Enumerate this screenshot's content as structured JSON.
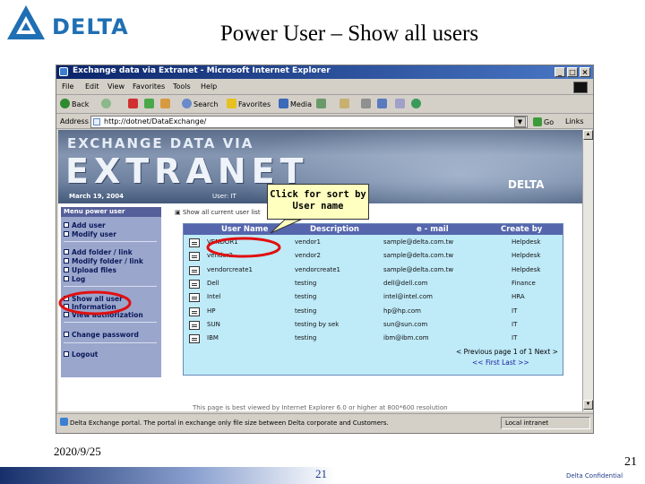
{
  "slide": {
    "logo_text": "DELTA",
    "title": "Power User – Show all users",
    "footer_date": "2020/9/25",
    "footer_page_center": "21",
    "footer_page_right": "21",
    "footer_confidential": "Delta Confidential"
  },
  "browser": {
    "window_title": "Exchange data via Extranet - Microsoft Internet Explorer",
    "menu": [
      "File",
      "Edit",
      "View",
      "Favorites",
      "Tools",
      "Help"
    ],
    "toolbar": {
      "back": "Back",
      "search": "Search",
      "favorites": "Favorites",
      "media": "Media"
    },
    "address_label": "Address",
    "address_value": "http://dotnet/DataExchange/",
    "go_label": "Go",
    "links_label": "Links",
    "status_message": "Delta Exchange portal. The portal in exchange only file size between Delta corporate and Customers.",
    "status_zone": "Local intranet"
  },
  "page": {
    "banner_line1": "EXCHANGE DATA VIA",
    "banner_line2": "EXTRANET",
    "banner_date": "March 19, 2004",
    "banner_user": "User: IT",
    "banner_logo": "DELTA",
    "menu_header": "Menu power user",
    "nav": [
      "Add user",
      "Modify user",
      "Add folder / link",
      "Modify folder / link",
      "Upload files",
      "Log",
      "Show all user",
      "Information",
      "View authorization",
      "Change password",
      "Logout"
    ],
    "breadcrumb": "Show all current user list",
    "table": {
      "headers": [
        "User Name",
        "Description",
        "e - mail",
        "Create by"
      ],
      "rows": [
        [
          "VENDOR1",
          "vendor1",
          "sample@delta.com.tw",
          "Helpdesk"
        ],
        [
          "vendor2",
          "vendor2",
          "sample@delta.com.tw",
          "Helpdesk"
        ],
        [
          "vendorcreate1",
          "vendorcreate1",
          "sample@delta.com.tw",
          "Helpdesk"
        ],
        [
          "Dell",
          "testing",
          "dell@dell.com",
          "Finance"
        ],
        [
          "Intel",
          "testing",
          "intel@intel.com",
          "HRA"
        ],
        [
          "HP",
          "testing",
          "hp@hp.com",
          "IT"
        ],
        [
          "SUN",
          "testing by sek",
          "sun@sun.com",
          "IT"
        ],
        [
          "IBM",
          "testing",
          "ibm@ibm.com",
          "IT"
        ]
      ]
    },
    "pager_line1": "< Previous page  1 of 1  Next >",
    "pager_line2": "<< First   Last >>",
    "bottom_hint": "This page is best viewed by Internet Explorer 6.0 or higher at 800*600 resolution"
  },
  "callout": {
    "line1": "Click for sort by",
    "line2": "User name"
  },
  "colors": {
    "table_bg": "#bfeaf8",
    "table_header": "#5566ad",
    "nav_bg": "#9aa6cc",
    "highlight_ring": "#e01010",
    "callout_bg": "#ffffc0"
  }
}
